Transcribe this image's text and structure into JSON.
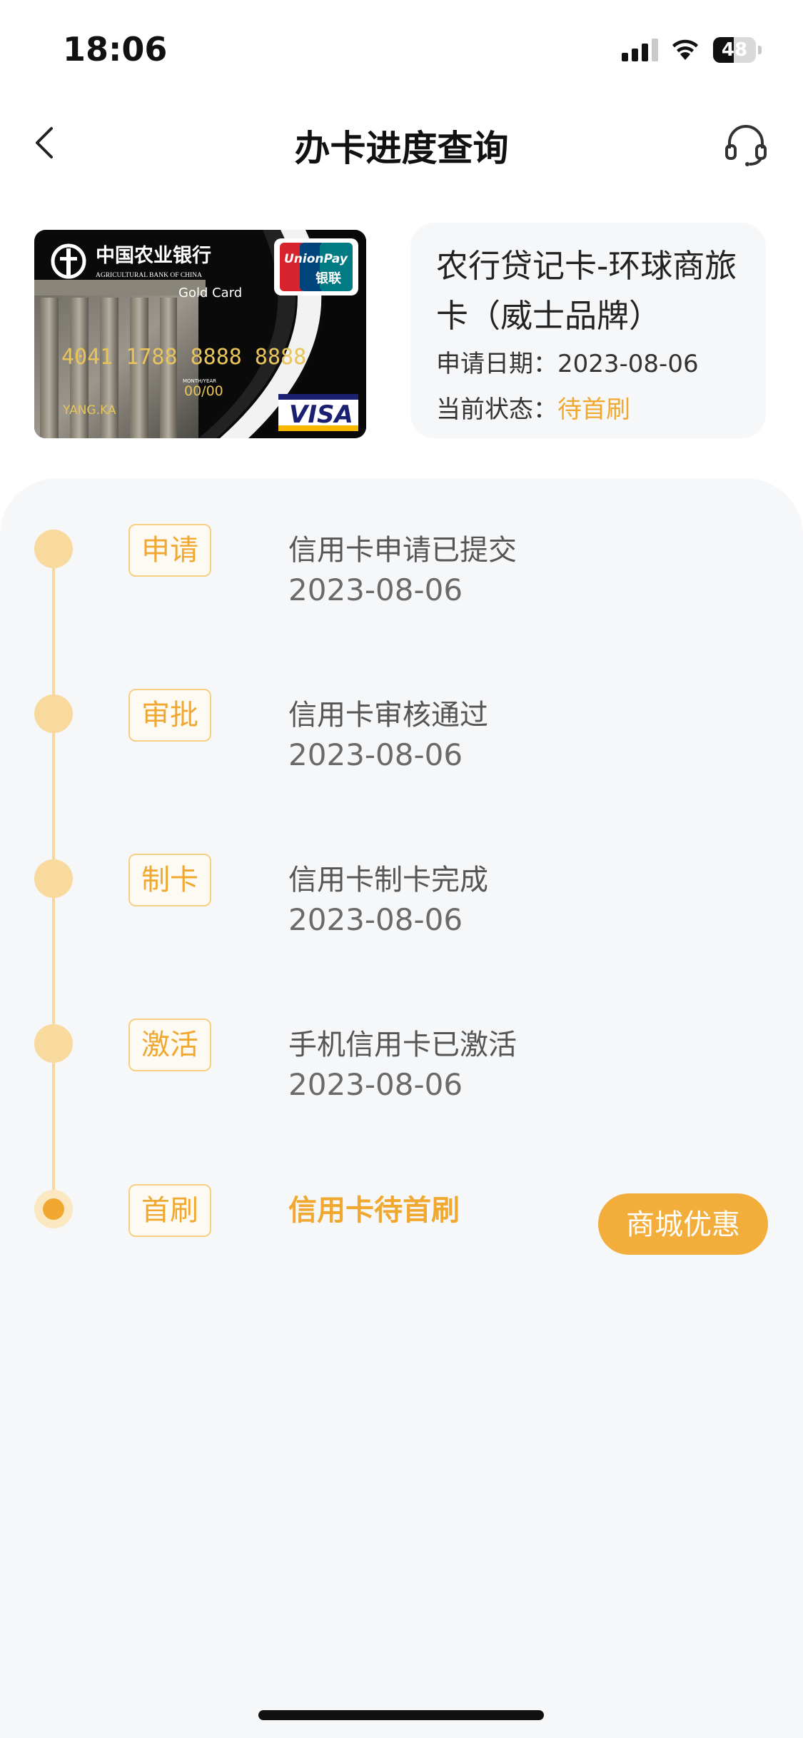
{
  "status_bar": {
    "time": "18:06",
    "battery_level": "48",
    "battery_fraction": 0.48,
    "icons": [
      "signal-icon",
      "wifi-icon",
      "battery-icon"
    ]
  },
  "nav": {
    "title": "办卡进度查询",
    "back_icon": "chevron-left-icon",
    "support_icon": "headset-icon"
  },
  "card": {
    "image": {
      "bank_name_cn": "中国农业银行",
      "bank_name_en": "AGRICULTURAL BANK OF CHINA",
      "card_tier": "Gold Card",
      "network_logo_1": "UnionPay",
      "network_logo_1_cn": "银联",
      "card_number": "4041 1788 8888 8888",
      "expiry_label": "MONTH/YEAR",
      "expiry_value": "00/00",
      "holder": "YANG.KA",
      "network_logo_2": "VISA"
    },
    "name": "农行贷记卡-环球商旅卡（威士品牌）",
    "apply_date_label": "申请日期：",
    "apply_date_value": "2023-08-06",
    "status_label": "当前状态：",
    "status_value": "待首刷"
  },
  "timeline": [
    {
      "tag": "申请",
      "title": "信用卡申请已提交",
      "date": "2023-08-06"
    },
    {
      "tag": "审批",
      "title": "信用卡审核通过",
      "date": "2023-08-06"
    },
    {
      "tag": "制卡",
      "title": "信用卡制卡完成",
      "date": "2023-08-06"
    },
    {
      "tag": "激活",
      "title": "手机信用卡已激活",
      "date": "2023-08-06"
    },
    {
      "tag": "首刷",
      "title": "信用卡待首刷",
      "date": ""
    }
  ],
  "actions": {
    "mall_button": "商城优惠"
  },
  "colors": {
    "accent": "#f0a830",
    "timeline_dot": "#f8da9f",
    "panel_bg": "#f6f7f9"
  }
}
